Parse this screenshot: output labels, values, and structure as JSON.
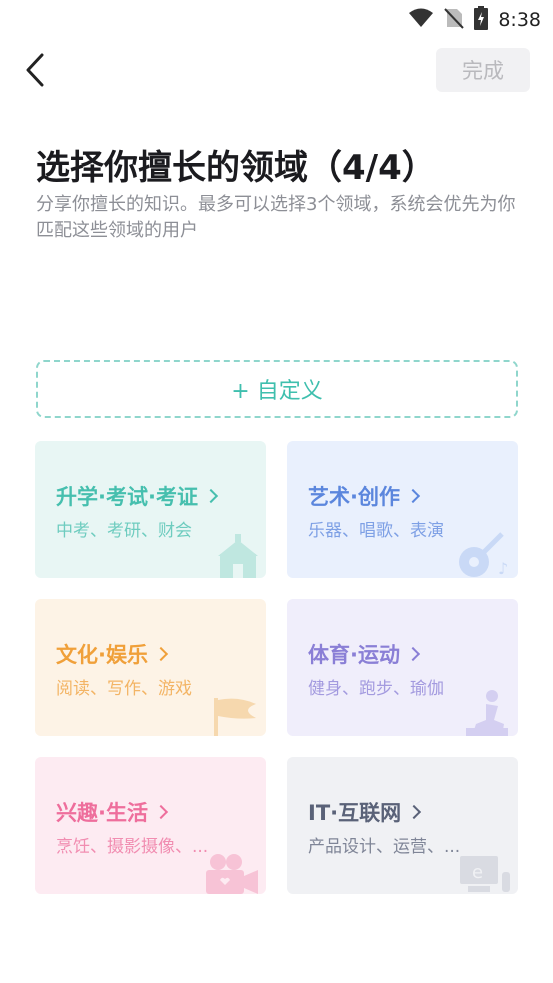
{
  "status_bar": {
    "time": "8:38"
  },
  "header": {
    "done_label": "完成"
  },
  "page": {
    "title": "选择你擅长的领域（4/4）",
    "subtitle": "分享你擅长的知识。最多可以选择3个领域，系统会优先为你匹配这些领域的用户"
  },
  "custom": {
    "label": "+ 自定义"
  },
  "categories": [
    {
      "title": "升学·考试·考证",
      "sub": "中考、考研、财会",
      "color": "#46bfae",
      "bg": "#e8f6f4"
    },
    {
      "title": "艺术·创作",
      "sub": "乐器、唱歌、表演",
      "color": "#5b86dd",
      "bg": "#e9f0fd"
    },
    {
      "title": "文化·娱乐",
      "sub": "阅读、写作、游戏",
      "color": "#f0a03a",
      "bg": "#fdf3e6"
    },
    {
      "title": "体育·运动",
      "sub": "健身、跑步、瑜伽",
      "color": "#8a7fd6",
      "bg": "#f0eefb"
    },
    {
      "title": "兴趣·生活",
      "sub": "烹饪、摄影摄像、...",
      "color": "#ee6e9c",
      "bg": "#fdebf2"
    },
    {
      "title": "IT·互联网",
      "sub": "产品设计、运营、...",
      "color": "#5a6278",
      "bg": "#f0f1f4"
    }
  ]
}
